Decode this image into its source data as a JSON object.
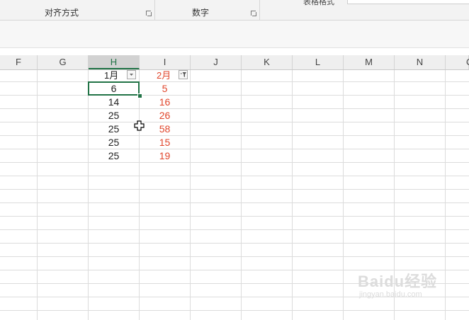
{
  "ribbon": {
    "groups": [
      {
        "label": "对齐方式"
      },
      {
        "label": "数字"
      }
    ],
    "table_styles_label": "表格格式"
  },
  "columns": [
    "F",
    "G",
    "H",
    "I",
    "J",
    "K",
    "L",
    "M",
    "N",
    "O"
  ],
  "selected_column": "H",
  "table": {
    "headers": [
      {
        "text": "1月",
        "color": "#222222"
      },
      {
        "text": "2月",
        "color": "#e0452b"
      }
    ],
    "rows": [
      [
        "6",
        "5"
      ],
      [
        "14",
        "16"
      ],
      [
        "25",
        "26"
      ],
      [
        "25",
        "58"
      ],
      [
        "25",
        "15"
      ],
      [
        "25",
        "19"
      ]
    ]
  },
  "filter_icons": {
    "col_h": "dropdown-arrow-icon",
    "col_i": "filter-active-icon"
  },
  "watermark": {
    "line1": "Baidu经验",
    "line2": "jingyan.baidu.com"
  },
  "accent": "#217346",
  "red_value_color": "#e0452b"
}
